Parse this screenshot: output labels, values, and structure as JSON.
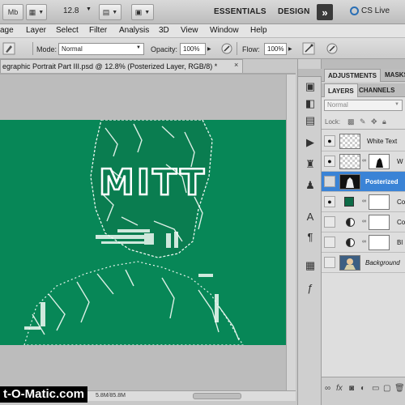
{
  "appbar": {
    "mb_label": "Mb",
    "zoom": "12.8",
    "workspaces": [
      "ESSENTIALS",
      "DESIGN"
    ],
    "more_glyph": "»",
    "cs_live": "CS Live"
  },
  "menu": {
    "items": [
      "age",
      "Layer",
      "Select",
      "Filter",
      "Analysis",
      "3D",
      "View",
      "Window",
      "Help"
    ]
  },
  "options": {
    "mode_label": "Mode:",
    "mode_value": "Normal",
    "opacity_label": "Opacity:",
    "opacity_value": "100%",
    "flow_label": "Flow:",
    "flow_value": "100%"
  },
  "document": {
    "tab_title": "egraphic Portrait Part III.psd @ 12.8% (Posterized Layer, RGB/8) *",
    "close_glyph": "×",
    "artwork_text": "MITT"
  },
  "status": {
    "doc_size": "5.8M/85.8M"
  },
  "watermark": "t-O-Matic.com",
  "panels": {
    "top_tabs": [
      "ADJUSTMENTS",
      "MASKS"
    ],
    "layer_tabs": [
      "LAYERS",
      "CHANNELS"
    ],
    "blend_mode": "Normal",
    "lock_label": "Lock:",
    "layers": [
      {
        "name": "White Text",
        "visible": true,
        "selected": false
      },
      {
        "name": "W",
        "visible": true,
        "selected": false
      },
      {
        "name": "Posterized",
        "visible": false,
        "selected": true
      },
      {
        "name": "Co",
        "visible": true,
        "selected": false
      },
      {
        "name": "Co",
        "visible": false,
        "selected": false
      },
      {
        "name": "Bl",
        "visible": false,
        "selected": false
      },
      {
        "name": "Background",
        "visible": false,
        "selected": false
      }
    ]
  },
  "colors": {
    "canvas_green": "#078757",
    "selection_blue": "#3a83d6",
    "layer_fill_green": "#0d6b47"
  }
}
